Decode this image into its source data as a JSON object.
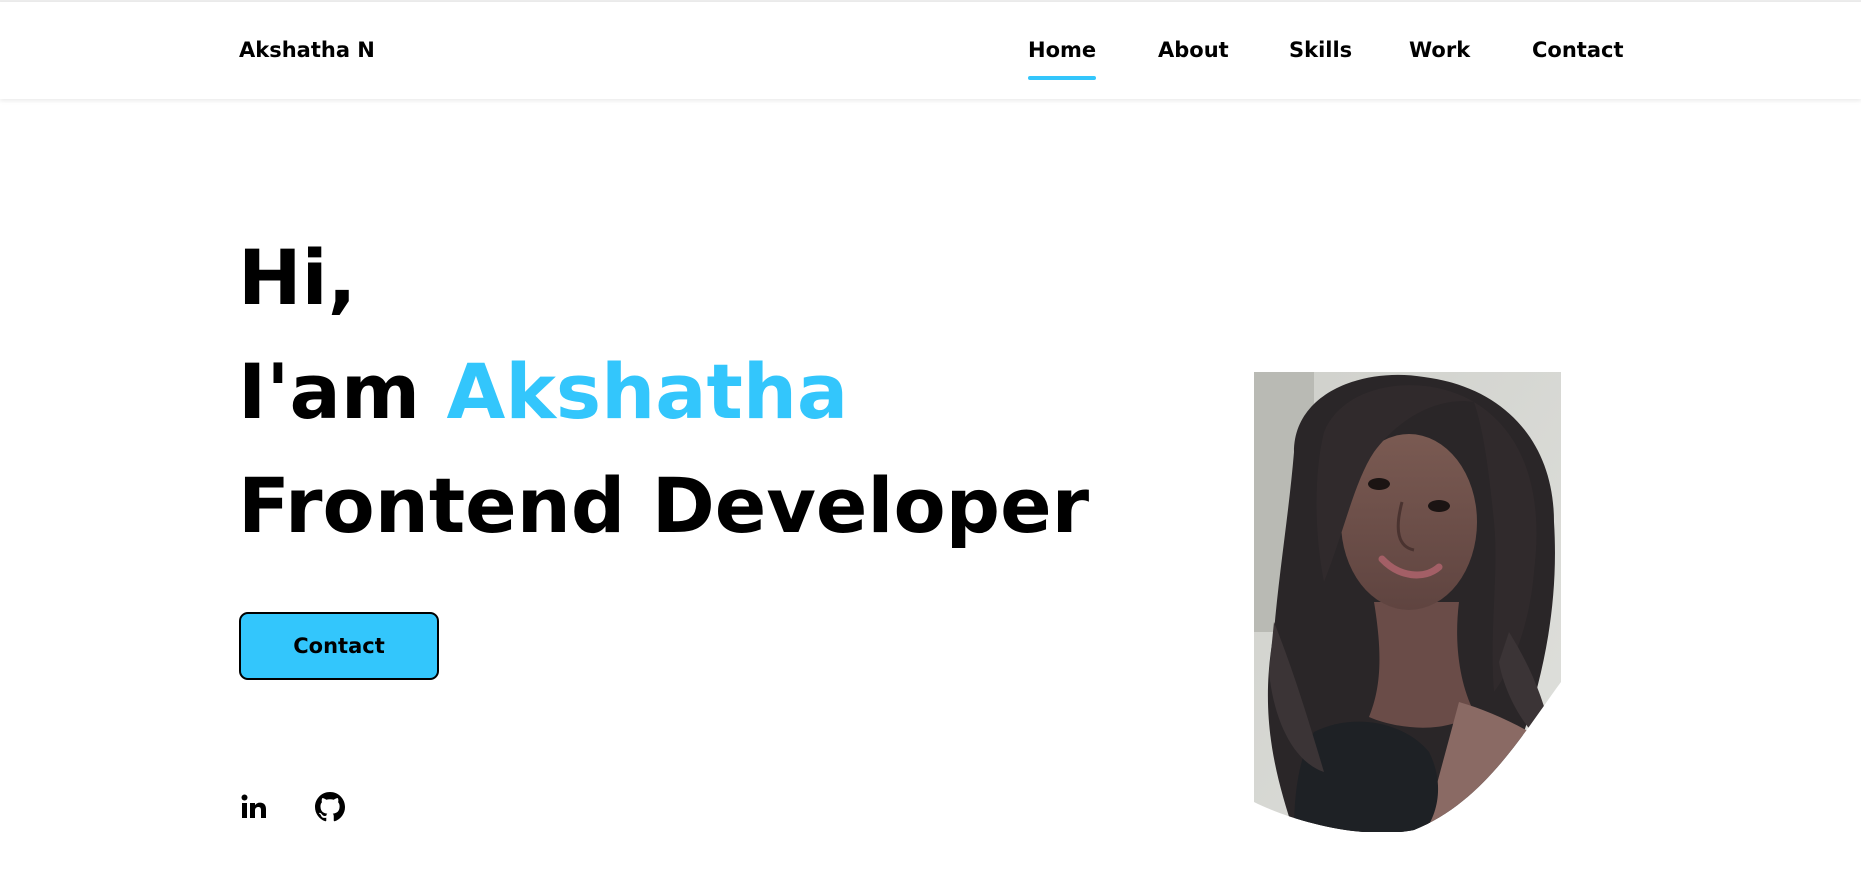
{
  "header": {
    "logo": "Akshatha N",
    "nav": [
      {
        "label": "Home",
        "active": true
      },
      {
        "label": "About",
        "active": false
      },
      {
        "label": "Skills",
        "active": false
      },
      {
        "label": "Work",
        "active": false
      },
      {
        "label": "Contact",
        "active": false
      }
    ]
  },
  "hero": {
    "greeting": "Hi,",
    "intro_prefix": "I'am",
    "name": "Akshatha",
    "role": "Frontend Developer",
    "contact_button": "Contact"
  },
  "social": [
    {
      "icon": "linkedin-icon"
    },
    {
      "icon": "github-icon"
    }
  ],
  "colors": {
    "accent": "#33c6fc",
    "text": "#000000",
    "background": "#ffffff"
  }
}
